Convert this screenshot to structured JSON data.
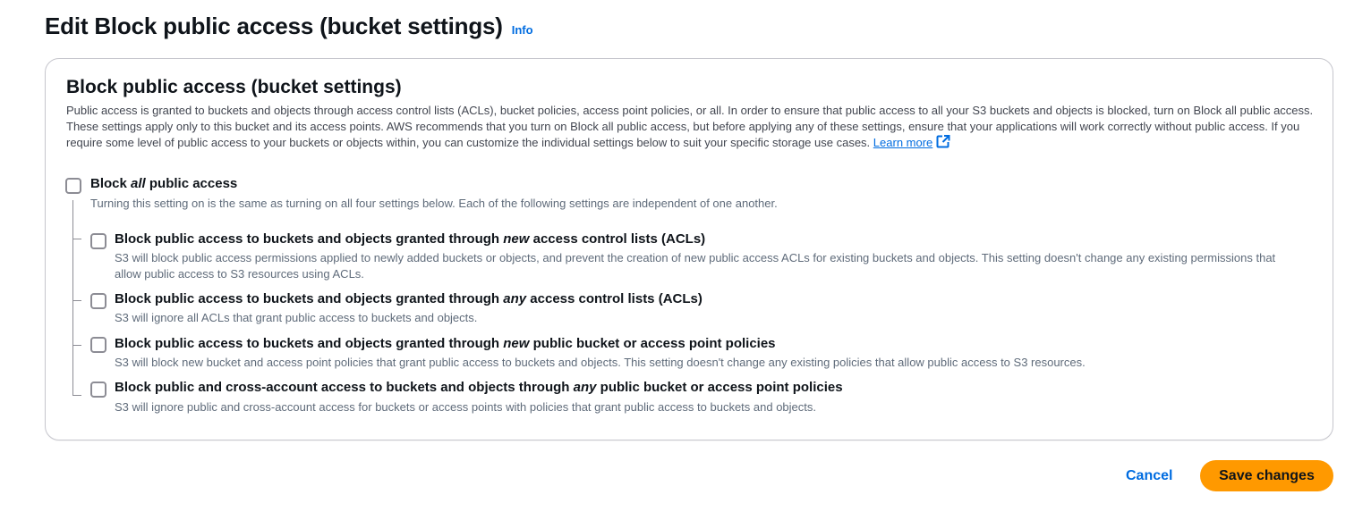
{
  "page": {
    "title": "Edit Block public access (bucket settings)",
    "info_label": "Info"
  },
  "panel": {
    "title": "Block public access (bucket settings)",
    "description": "Public access is granted to buckets and objects through access control lists (ACLs), bucket policies, access point policies, or all. In order to ensure that public access to all your S3 buckets and objects is blocked, turn on Block all public access. These settings apply only to this bucket and its access points. AWS recommends that you turn on Block all public access, but before applying any of these settings, ensure that your applications will work correctly without public access. If you require some level of public access to your buckets or objects within, you can customize the individual settings below to suit your specific storage use cases.",
    "learn_more": "Learn more"
  },
  "block_all": {
    "label_before": "Block ",
    "label_em": "all",
    "label_after": " public access",
    "description": "Turning this setting on is the same as turning on all four settings below. Each of the following settings are independent of one another.",
    "checked": false
  },
  "options": [
    {
      "label_before": "Block public access to buckets and objects granted through ",
      "label_em": "new",
      "label_after": " access control lists (ACLs)",
      "description": "S3 will block public access permissions applied to newly added buckets or objects, and prevent the creation of new public access ACLs for existing buckets and objects. This setting doesn't change any existing permissions that allow public access to S3 resources using ACLs.",
      "checked": false
    },
    {
      "label_before": "Block public access to buckets and objects granted through ",
      "label_em": "any",
      "label_after": " access control lists (ACLs)",
      "description": "S3 will ignore all ACLs that grant public access to buckets and objects.",
      "checked": false
    },
    {
      "label_before": "Block public access to buckets and objects granted through ",
      "label_em": "new",
      "label_after": " public bucket or access point policies",
      "description": "S3 will block new bucket and access point policies that grant public access to buckets and objects. This setting doesn't change any existing policies that allow public access to S3 resources.",
      "checked": false
    },
    {
      "label_before": "Block public and cross-account access to buckets and objects through ",
      "label_em": "any",
      "label_after": " public bucket or access point policies",
      "description": "S3 will ignore public and cross-account access for buckets or access points with policies that grant public access to buckets and objects.",
      "checked": false
    }
  ],
  "actions": {
    "cancel": "Cancel",
    "save": "Save changes"
  },
  "colors": {
    "link": "#006ce0",
    "primary_button": "#ff9900",
    "text": "#0f141a",
    "secondary_text": "#5f6b7a",
    "border": "#c6c6cd"
  },
  "icons": {
    "external_link": "external-link-icon"
  }
}
